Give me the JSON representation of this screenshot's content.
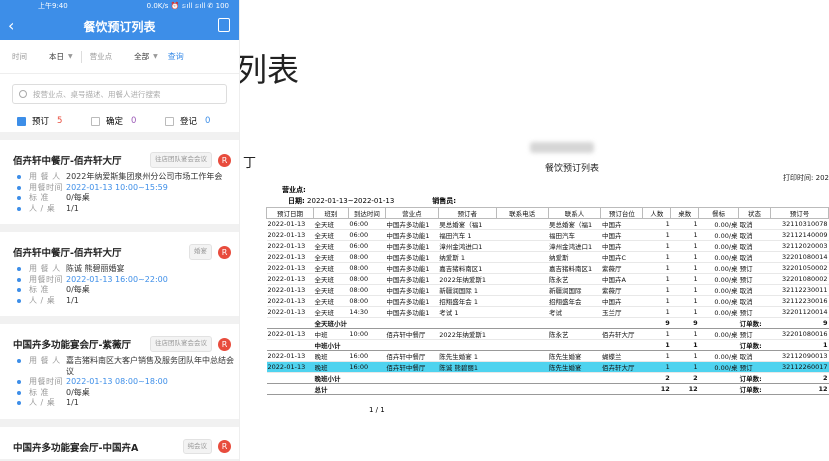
{
  "background_title": "列表",
  "fragment": "丁",
  "phone": {
    "status_time": "上午9:40",
    "status_info": "0.0K/s ⏰ 𝚜ıll 𝚜ıll ✆ 100",
    "nav_title": "餐饮预订列表",
    "filter": {
      "time_label": "时间",
      "time_value": "本日",
      "place_label": "营业点",
      "place_value": "全部",
      "query": "查询"
    },
    "search_placeholder": "按营业点、桌号描述、用餐人进行搜索",
    "tabs": [
      {
        "label": "预订",
        "count": "5",
        "count_color": "#e84c3d",
        "checked": true
      },
      {
        "label": "确定",
        "count": "0",
        "count_color": "#9b59b6",
        "checked": false
      },
      {
        "label": "登记",
        "count": "0",
        "count_color": "#3d8ee8",
        "checked": false
      }
    ],
    "cards": [
      {
        "name": "佰卉轩中餐厅-佰卉轩大厅",
        "tag": "往店团队宴会会议",
        "badge": "R",
        "rows": [
          {
            "label": "用 餐 人",
            "value": "2022年纳爱斯集团泉州分公司市场工作年会",
            "blue": false
          },
          {
            "label": "用餐时间",
            "value": "2022-01-13 10:00~15:59",
            "blue": true
          },
          {
            "label": "标    准",
            "value": "0/每桌",
            "blue": false
          },
          {
            "label": "人 / 桌",
            "value": "1/1",
            "blue": false
          }
        ]
      },
      {
        "name": "佰卉轩中餐厅-佰卉轩大厅",
        "tag": "婚宴",
        "badge": "R",
        "rows": [
          {
            "label": "用 餐 人",
            "value": "陈诚 熊碧丽婚宴",
            "blue": false
          },
          {
            "label": "用餐时间",
            "value": "2022-01-13 16:00~22:00",
            "blue": true
          },
          {
            "label": "标    准",
            "value": "0/每桌",
            "blue": false
          },
          {
            "label": "人 / 桌",
            "value": "1/1",
            "blue": false
          }
        ]
      },
      {
        "name": "中国卉多功能宴会厅-紫薇厅",
        "tag": "往店团队宴会会议",
        "badge": "R",
        "rows": [
          {
            "label": "用 餐 人",
            "value": "嘉吉猪料南区大客户销售及服务团队年中总结会议",
            "blue": false
          },
          {
            "label": "用餐时间",
            "value": "2022-01-13 08:00~18:00",
            "blue": true
          },
          {
            "label": "标    准",
            "value": "0/每桌",
            "blue": false
          },
          {
            "label": "人 / 桌",
            "value": "1/1",
            "blue": false
          }
        ]
      },
      {
        "name": "中国卉多功能宴会厅-中国卉A",
        "tag": "纯会议",
        "badge": "R",
        "rows": []
      }
    ]
  },
  "doc": {
    "title": "餐饮预订列表",
    "print_time": "打印时间: 202",
    "place_label": "营业点:",
    "date_label": "日期:",
    "date_value": "2022-01-13~2022-01-13",
    "seller_label": "销售员:",
    "headers": [
      "预订日期",
      "班别",
      "到达时间",
      "营业点",
      "预订者",
      "联系电话",
      "联系人",
      "预订台位",
      "人数",
      "桌数",
      "餐标",
      "状态",
      "预订号"
    ],
    "rows": [
      {
        "type": "d",
        "cells": [
          "2022-01-13",
          "全天班",
          "06:00",
          "中国卉多功能1",
          "吴总婚宴（福1",
          "",
          "吴总婚宴（福1",
          "中国卉",
          "1",
          "1",
          "0.00/桌",
          "取消",
          "32110310078"
        ]
      },
      {
        "type": "d",
        "cells": [
          "2022-01-13",
          "全天班",
          "06:00",
          "中国卉多功能1",
          "福田汽车   1",
          "",
          "福田汽车",
          "中国卉",
          "1",
          "1",
          "0.00/桌",
          "取消",
          "32112140009"
        ]
      },
      {
        "type": "d",
        "cells": [
          "2022-01-13",
          "全天班",
          "06:00",
          "中国卉多功能1",
          "漳州金鸿进口1",
          "",
          "漳州金鸿进口1",
          "中国卉",
          "1",
          "1",
          "0.00/桌",
          "取消",
          "32112020003"
        ]
      },
      {
        "type": "d",
        "cells": [
          "2022-01-13",
          "全天班",
          "08:00",
          "中国卉多功能1",
          "纳爱斯    1",
          "",
          "纳爱斯",
          "中国卉C",
          "1",
          "1",
          "0.00/桌",
          "取消",
          "32201080014"
        ]
      },
      {
        "type": "d",
        "cells": [
          "2022-01-13",
          "全天班",
          "08:00",
          "中国卉多功能1",
          "嘉吉猪料南区1",
          "",
          "嘉吉猪料南区1",
          "紫薇厅",
          "1",
          "1",
          "0.00/桌",
          "预订",
          "32201050002"
        ]
      },
      {
        "type": "d",
        "cells": [
          "2022-01-13",
          "全天班",
          "08:00",
          "中国卉多功能1",
          "2022年纳爱斯1",
          "",
          "陈永艺",
          "中国卉A",
          "1",
          "1",
          "0.00/桌",
          "预订",
          "32201080002"
        ]
      },
      {
        "type": "d",
        "cells": [
          "2022-01-13",
          "全天班",
          "08:00",
          "中国卉多功能1",
          "新疆润国际  1",
          "",
          "新疆润国际",
          "紫薇厅",
          "1",
          "1",
          "0.00/桌",
          "取消",
          "32112230011"
        ]
      },
      {
        "type": "d",
        "cells": [
          "2022-01-13",
          "全天班",
          "08:00",
          "中国卉多功能1",
          "招翔盛年会  1",
          "",
          "招翔盛年会",
          "中国卉",
          "1",
          "1",
          "0.00/桌",
          "取消",
          "32112230016"
        ]
      },
      {
        "type": "d",
        "cells": [
          "2022-01-13",
          "全天班",
          "14:30",
          "中国卉多功能1",
          "考试      1",
          "",
          "考试",
          "玉兰厅",
          "1",
          "1",
          "0.00/桌",
          "预订",
          "32201120014"
        ]
      },
      {
        "type": "s",
        "cells": [
          "",
          "全天班小计",
          "",
          "",
          "",
          "",
          "",
          "",
          "9",
          "9",
          "",
          "订单数:",
          "9"
        ]
      },
      {
        "type": "d",
        "cells": [
          "2022-01-13",
          "中班",
          "10:00",
          "佰卉轩中餐厅",
          "2022年纳爱斯1",
          "",
          "陈永艺",
          "佰卉轩大厅",
          "1",
          "1",
          "0.00/桌",
          "预订",
          "32201080016"
        ]
      },
      {
        "type": "s",
        "cells": [
          "",
          "中班小计",
          "",
          "",
          "",
          "",
          "",
          "",
          "1",
          "1",
          "",
          "订单数:",
          "1"
        ]
      },
      {
        "type": "d",
        "cells": [
          "2022-01-13",
          "晚班",
          "16:00",
          "佰卉轩中餐厅",
          "陈先生婚宴  1",
          "",
          "陈先生婚宴",
          "蝴蝶兰",
          "1",
          "1",
          "0.00/桌",
          "取消",
          "32112090013"
        ]
      },
      {
        "type": "h",
        "cells": [
          "2022-01-13",
          "晚班",
          "16:00",
          "佰卉轩中餐厅",
          "陈诚 熊碧丽1",
          "",
          "陈先生婚宴",
          "佰卉轩大厅",
          "1",
          "1",
          "0.00/桌",
          "预订",
          "32112260017"
        ]
      },
      {
        "type": "s",
        "cells": [
          "",
          "晚班小计",
          "",
          "",
          "",
          "",
          "",
          "",
          "2",
          "2",
          "",
          "订单数:",
          "2"
        ]
      },
      {
        "type": "s",
        "cells": [
          "",
          "总计",
          "",
          "",
          "",
          "",
          "",
          "",
          "12",
          "12",
          "",
          "订单数:",
          "12"
        ]
      }
    ],
    "pager": "1 / 1"
  }
}
